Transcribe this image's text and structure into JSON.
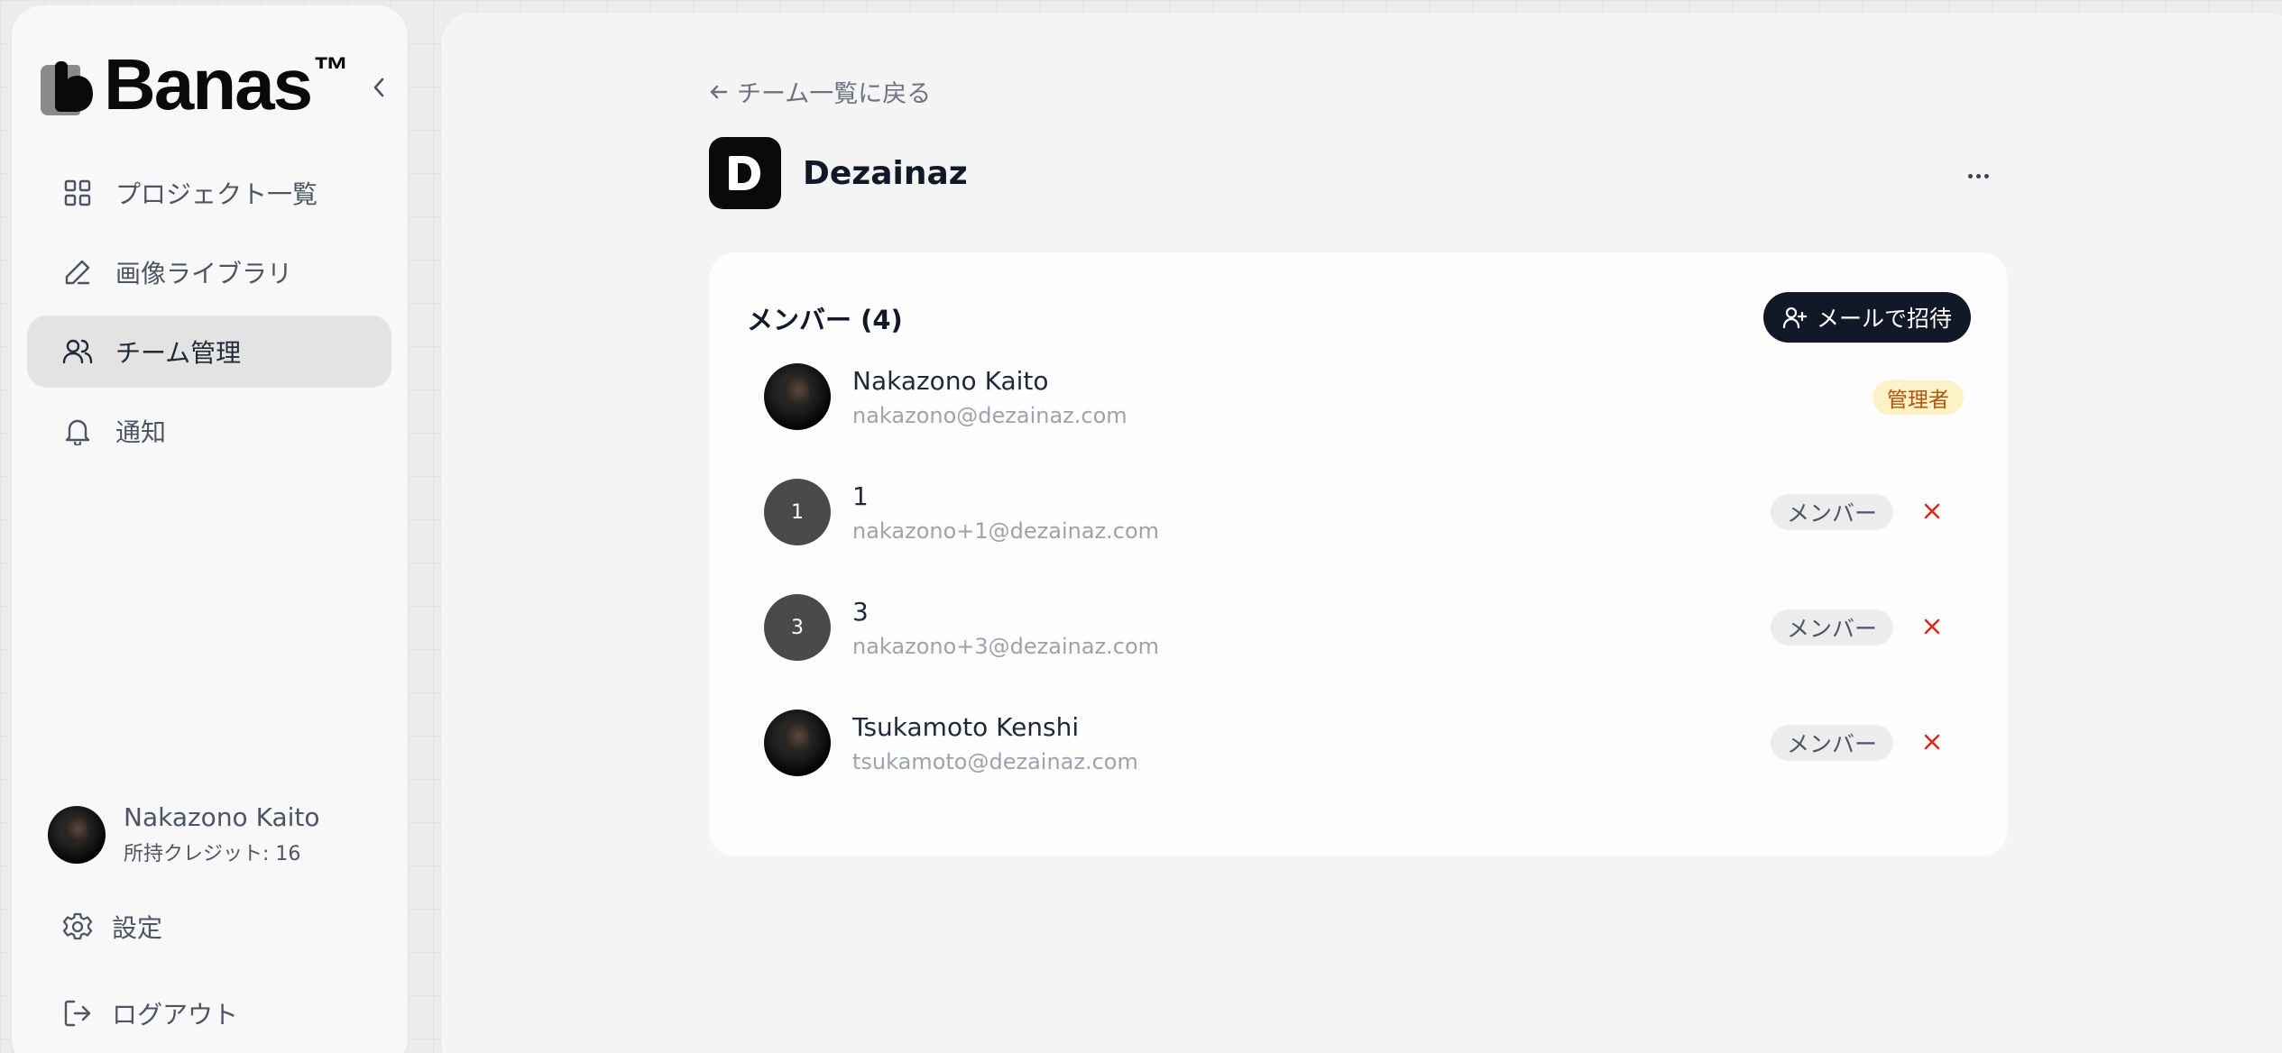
{
  "sidebar": {
    "logo_text": "Banas",
    "logo_tm": "™",
    "nav": [
      {
        "label": "プロジェクト一覧",
        "icon": "grid-icon"
      },
      {
        "label": "画像ライブラリ",
        "icon": "pencil-icon"
      },
      {
        "label": "チーム管理",
        "icon": "users-icon",
        "active": true
      },
      {
        "label": "通知",
        "icon": "bell-icon"
      }
    ],
    "user": {
      "name": "Nakazono Kaito",
      "credits": "所持クレジット: 16"
    },
    "settings_label": "設定",
    "logout_label": "ログアウト"
  },
  "main": {
    "back_label": "チーム一覧に戻る",
    "team_name": "Dezainaz",
    "team_initial": "D",
    "members_title": "メンバー (4)",
    "invite_label": "メールで招待",
    "members": [
      {
        "name": "Nakazono Kaito",
        "email": "nakazono@dezainaz.com",
        "role": "管理者",
        "avatar": "photo"
      },
      {
        "name": "1",
        "email": "nakazono+1@dezainaz.com",
        "role": "メンバー",
        "avatar_text": "1"
      },
      {
        "name": "3",
        "email": "nakazono+3@dezainaz.com",
        "role": "メンバー",
        "avatar_text": "3"
      },
      {
        "name": "Tsukamoto Kenshi",
        "email": "tsukamoto@dezainaz.com",
        "role": "メンバー",
        "avatar": "photo"
      }
    ]
  },
  "colors": {
    "accent_dark": "#111827",
    "admin_badge_bg": "#fdf1c7",
    "admin_badge_text": "#b45309",
    "remove_red": "#dc2626"
  }
}
